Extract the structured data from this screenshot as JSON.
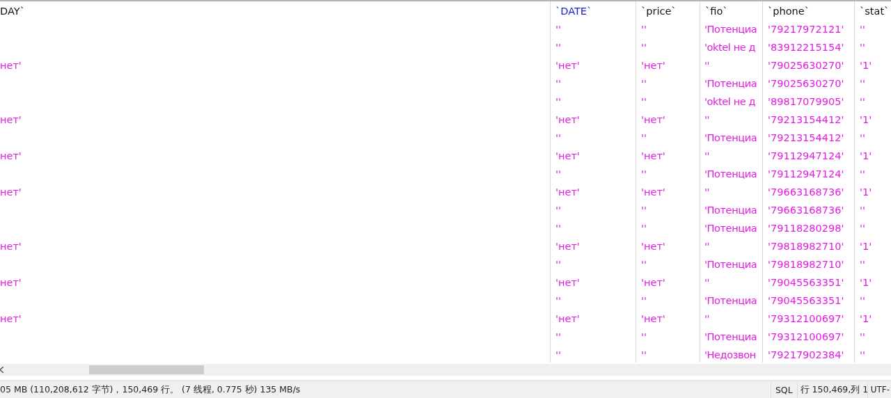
{
  "table": {
    "columns": [
      {
        "label": "DAY`",
        "selected": false
      },
      {
        "label": "`DATE`",
        "selected": true
      },
      {
        "label": "`price`",
        "selected": false
      },
      {
        "label": "`fio`",
        "selected": false
      },
      {
        "label": "`phone`",
        "selected": false
      },
      {
        "label": "`stat`",
        "selected": false
      }
    ],
    "rows": [
      [
        null,
        "''",
        "''",
        "'Потенциа",
        "'79217972121'",
        "''"
      ],
      [
        null,
        "''",
        "''",
        "'oktel не д",
        "'83912215154'",
        "''"
      ],
      [
        "нет'",
        "'нет'",
        "'нет'",
        "''",
        "'79025630270'",
        "'1'"
      ],
      [
        null,
        "''",
        "''",
        "'Потенциа",
        "'79025630270'",
        "''"
      ],
      [
        null,
        "''",
        "''",
        "'oktel не д",
        "'89817079905'",
        "''"
      ],
      [
        "нет'",
        "'нет'",
        "'нет'",
        "''",
        "'79213154412'",
        "'1'"
      ],
      [
        null,
        "''",
        "''",
        "'Потенциа",
        "'79213154412'",
        "''"
      ],
      [
        "нет'",
        "'нет'",
        "'нет'",
        "''",
        "'79112947124'",
        "'1'"
      ],
      [
        null,
        "''",
        "''",
        "'Потенциа",
        "'79112947124'",
        "''"
      ],
      [
        "нет'",
        "'нет'",
        "'нет'",
        "''",
        "'79663168736'",
        "'1'"
      ],
      [
        null,
        "''",
        "''",
        "'Потенциа",
        "'79663168736'",
        "''"
      ],
      [
        null,
        "''",
        "''",
        "'Потенциа",
        "'79118280298'",
        "''"
      ],
      [
        "нет'",
        "'нет'",
        "'нет'",
        "''",
        "'79818982710'",
        "'1'"
      ],
      [
        null,
        "''",
        "''",
        "'Потенциа",
        "'79818982710'",
        "''"
      ],
      [
        "нет'",
        "'нет'",
        "'нет'",
        "''",
        "'79045563351'",
        "'1'"
      ],
      [
        null,
        "''",
        "''",
        "'Потенциа",
        "'79045563351'",
        "''"
      ],
      [
        "нет'",
        "'нет'",
        "'нет'",
        "''",
        "'79312100697'",
        "'1'"
      ],
      [
        null,
        "''",
        "''",
        "'Потенциа",
        "'79312100697'",
        "''"
      ],
      [
        null,
        "''",
        "''",
        "'Недозвон",
        "'79217902384'",
        "''"
      ]
    ]
  },
  "status_bar": {
    "message": "05 MB (110,208,612 字节)，150,469 行。 (7 线程, 0.775 秒) 135 MB/s",
    "language": "SQL",
    "position": "行 150,469,列 1",
    "encoding": "UTF-"
  }
}
